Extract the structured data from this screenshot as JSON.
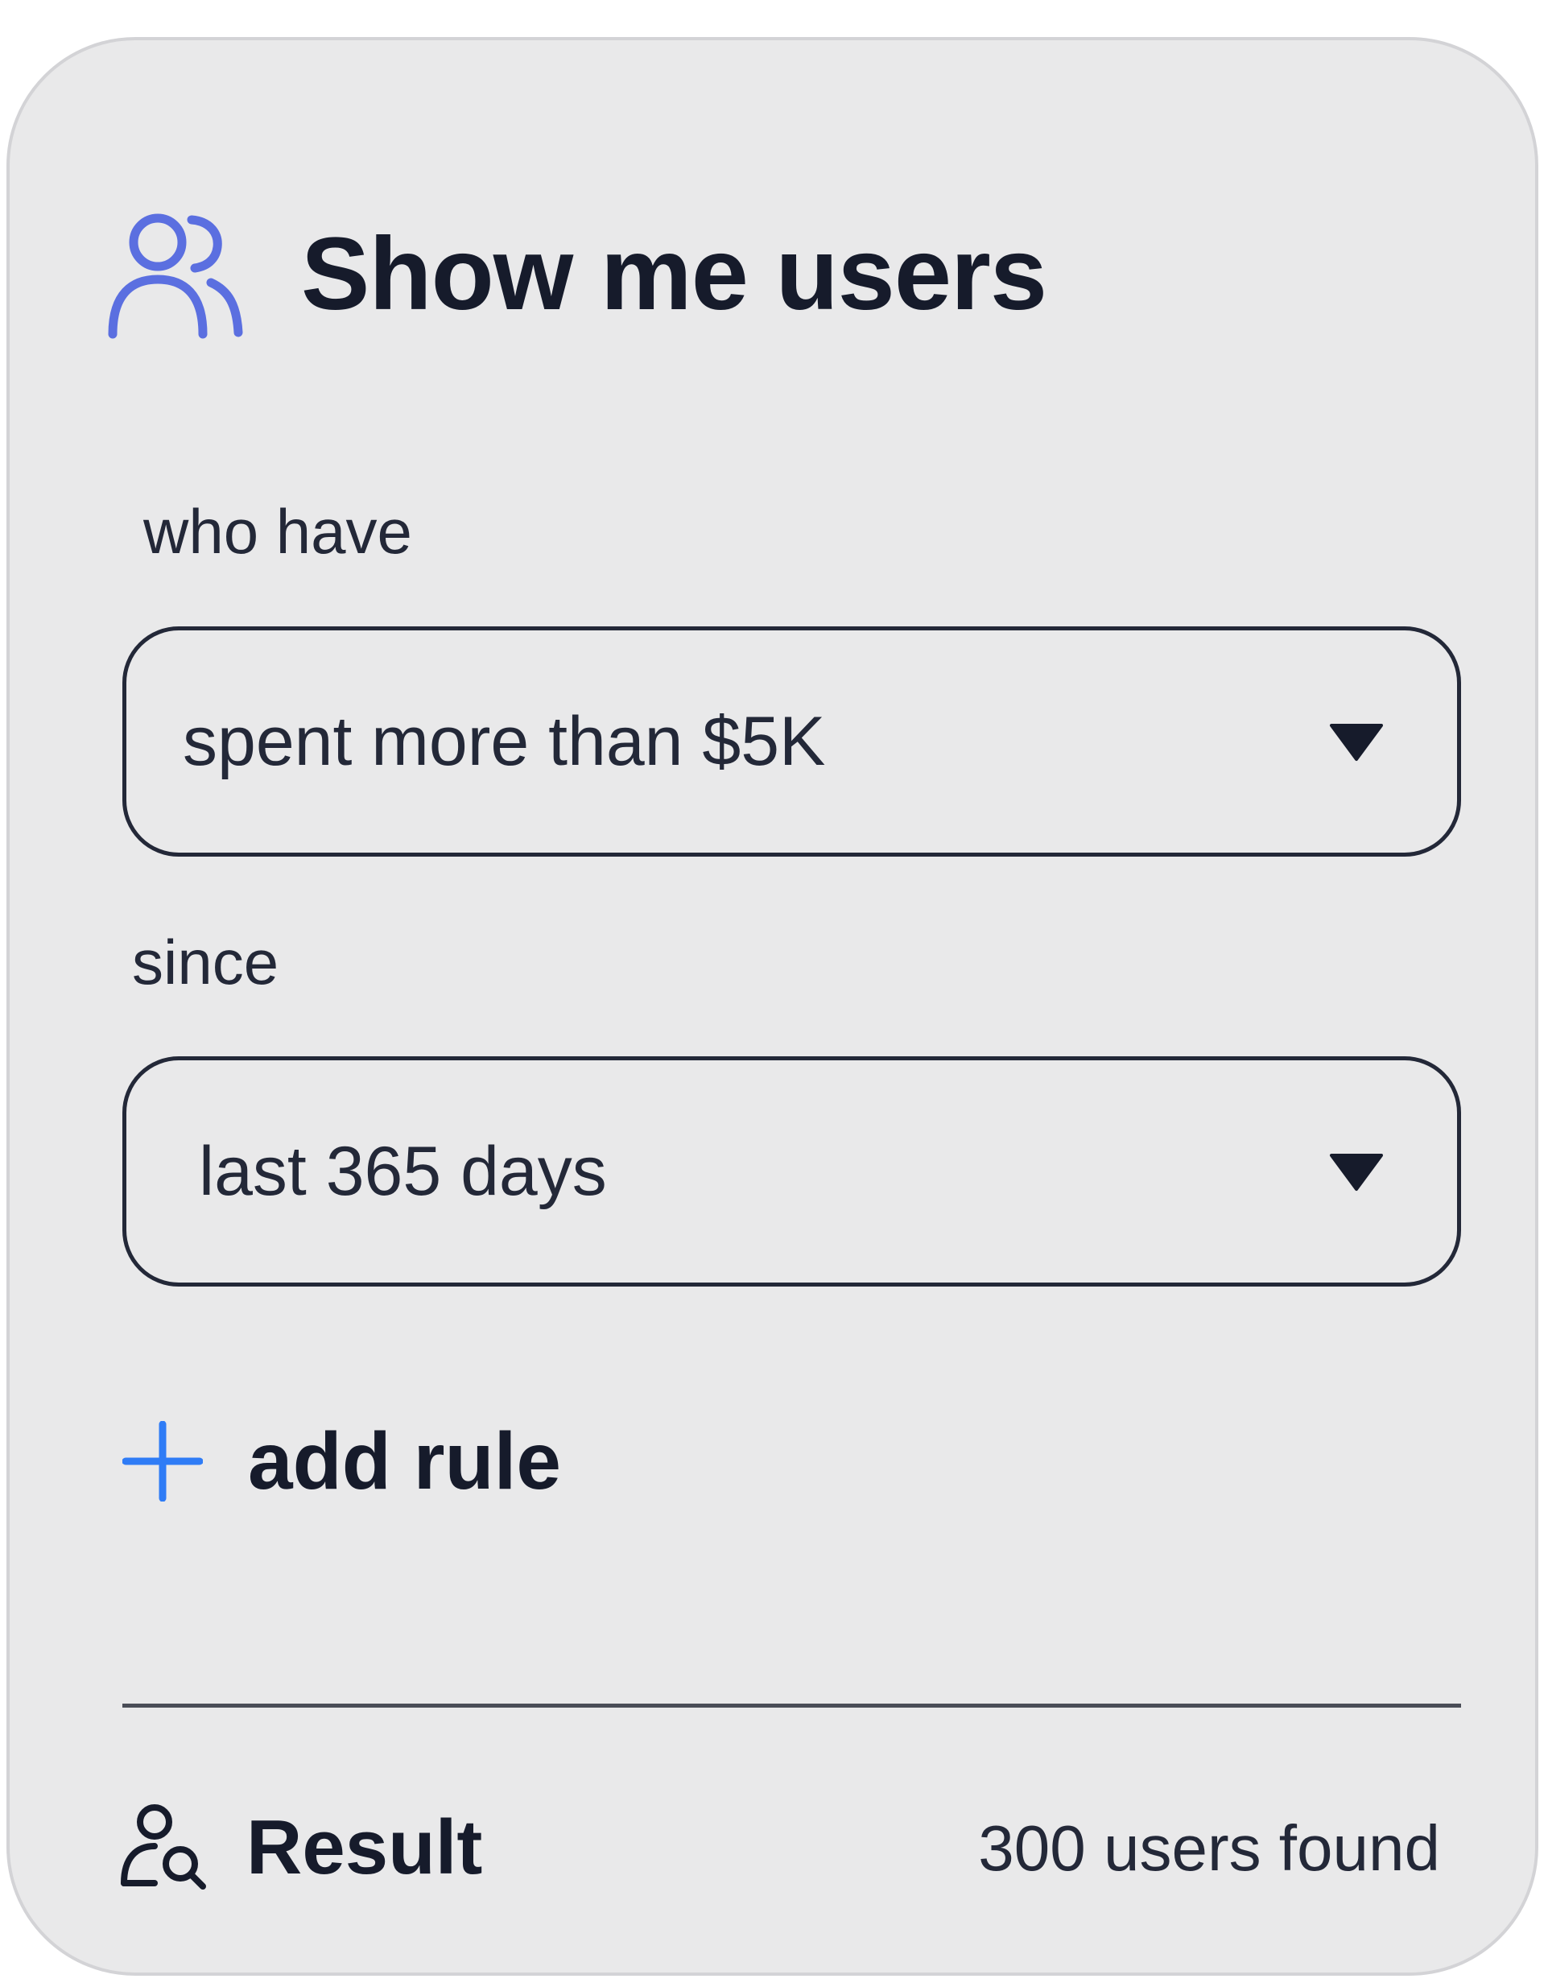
{
  "header": {
    "title": "Show me users",
    "icon": "users-icon"
  },
  "rules": [
    {
      "label": "who have",
      "value": "spent more than $5K",
      "icon": "caret-down-icon"
    },
    {
      "label": "since",
      "value": "last 365 days",
      "icon": "caret-down-icon"
    }
  ],
  "add_rule": {
    "label": "add rule",
    "icon": "plus-icon"
  },
  "result": {
    "label": "Result",
    "count": "300 users found",
    "icon": "user-search-icon"
  },
  "colors": {
    "card_background": "#e9e9ea",
    "users_icon": "#5b6fe0",
    "plus_icon": "#2f7cf6",
    "text": "#161b2b"
  }
}
